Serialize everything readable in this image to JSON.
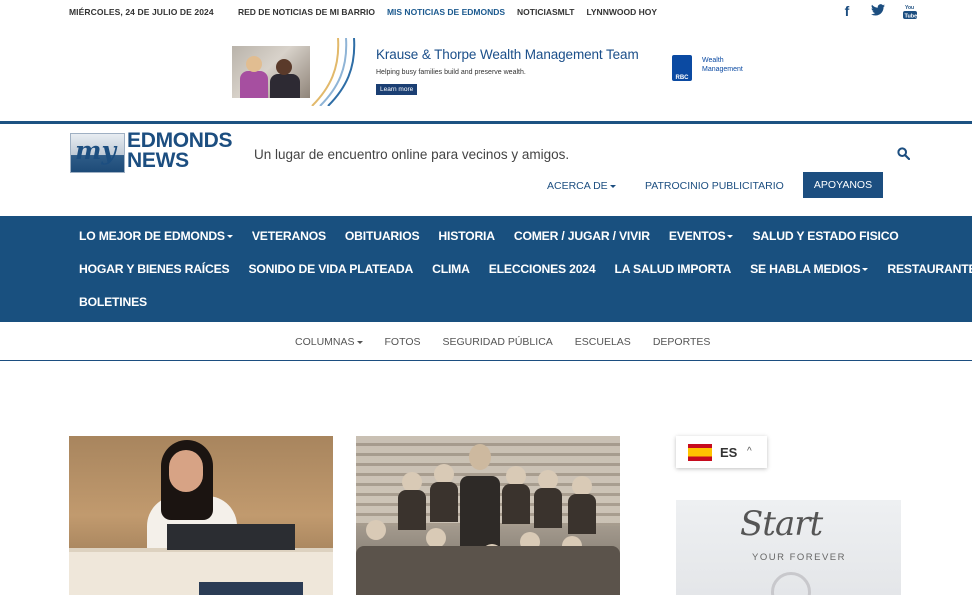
{
  "topbar": {
    "date": "MIÉRCOLES, 24 DE JULIO DE 2024",
    "links": [
      "RED DE NOTICIAS DE MI BARRIO",
      "MIS NOTICIAS DE EDMONDS",
      "NOTICIASMLT",
      "LYNNWOOD HOY"
    ],
    "social_icons": [
      "facebook-icon",
      "twitter-icon",
      "youtube-icon"
    ]
  },
  "ad": {
    "title": "Krause & Thorpe Wealth Management Team",
    "subtitle": "Helping busy families build and preserve wealth.",
    "cta": "Learn more",
    "brand": "RBC",
    "brand_sub": "Wealth Management"
  },
  "header": {
    "logo_my": "my",
    "logo_name_1": "EDMONDS",
    "logo_name_2": "NEWS",
    "tagline": "Un lugar de encuentro online para vecinos y amigos.",
    "links": {
      "about": "ACERCA DE",
      "sponsor": "PATROCINIO PUBLICITARIO",
      "support": "APOYANOS"
    }
  },
  "mainnav": {
    "row1": [
      "LO MEJOR DE EDMONDS",
      "VETERANOS",
      "OBITUARIOS",
      "HISTORIA",
      "COMER / JUGAR / VIVIR",
      "EVENTOS",
      "SALUD Y ESTADO FISICO"
    ],
    "row2": [
      "HOGAR Y BIENES RAÍCES",
      "SONIDO DE VIDA PLATEADA",
      "CLIMA",
      "ELECCIONES 2024",
      "LA SALUD IMPORTA",
      "SE HABLA MEDIOS",
      "RESTAURANTES"
    ],
    "row3": [
      "BOLETINES"
    ]
  },
  "secnav": [
    "COLUMNAS",
    "FOTOS",
    "SEGURIDAD PÚBLICA",
    "ESCUELAS",
    "DEPORTES"
  ],
  "language": {
    "code": "ES"
  },
  "ad2": {
    "headline": "Start",
    "sub": "YOUR FOREVER"
  },
  "colors": {
    "brand": "#1c4e80",
    "nav_bg": "#19507f"
  }
}
